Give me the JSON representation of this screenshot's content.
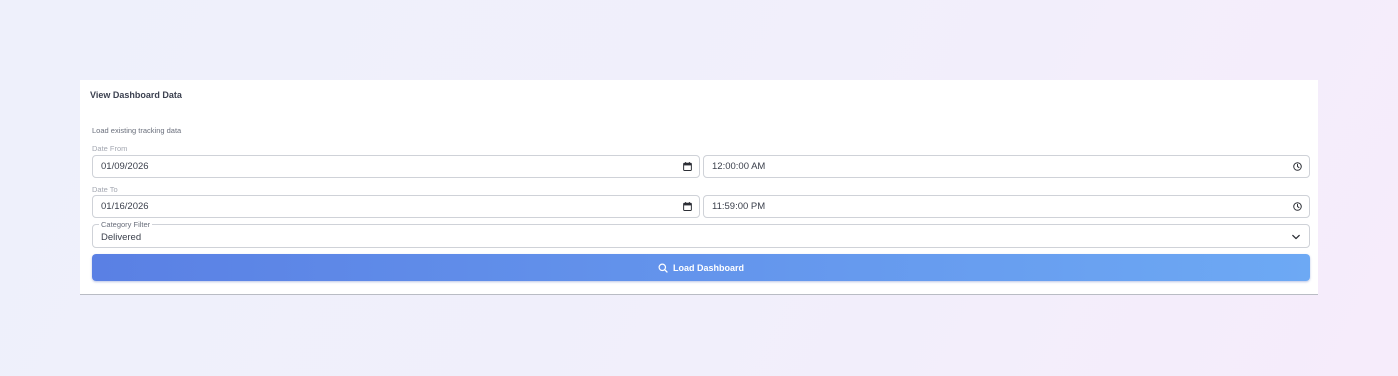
{
  "card": {
    "title": "View Dashboard Data",
    "subtitle": "Load existing tracking data"
  },
  "date_from": {
    "label": "Date From",
    "date_value": "01/09/2026",
    "time_value": "12:00:00 AM"
  },
  "date_to": {
    "label": "Date To",
    "date_value": "01/16/2026",
    "time_value": "11:59:00 PM"
  },
  "category_filter": {
    "label": "Category Filter",
    "value": "Delivered"
  },
  "load_button": {
    "label": "Load Dashboard",
    "icon": "search-icon"
  },
  "colors": {
    "button_gradient_start": "#5a80e4",
    "button_gradient_end": "#6da9f4",
    "title_text": "#3c4150",
    "muted_label": "#a3a7b1"
  }
}
